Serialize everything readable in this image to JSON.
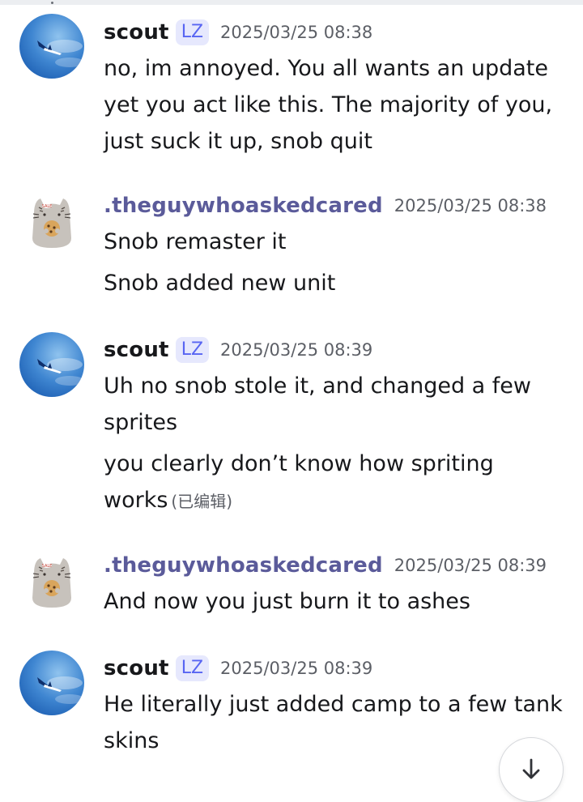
{
  "messages": [
    {
      "author": "scout",
      "tag": "LZ",
      "timestamp": "2025/03/25 08:38",
      "avatar": "blue-sky-plane-avatar",
      "lines": [
        "no, im annoyed. You all wants an update",
        "yet you act like this. The majority of you,",
        "just suck it up, snob quit"
      ]
    },
    {
      "author": ".theguywhoaskedcared",
      "timestamp": "2025/03/25 08:38",
      "avatar": "pusheen-cat-cookie-avatar",
      "lines": [
        "Snob remaster it",
        "Snob added new unit"
      ]
    },
    {
      "author": "scout",
      "tag": "LZ",
      "timestamp": "2025/03/25 08:39",
      "avatar": "blue-sky-plane-avatar",
      "lines": [
        "Uh no snob stole it, and changed a few",
        "sprites",
        "you clearly don’t know how spriting",
        "works"
      ],
      "edited_label": "(已编辑)"
    },
    {
      "author": ".theguywhoaskedcared",
      "timestamp": "2025/03/25 08:39",
      "avatar": "pusheen-cat-cookie-avatar",
      "lines": [
        "And now you just burn it to ashes"
      ]
    },
    {
      "author": "scout",
      "tag": "LZ",
      "timestamp": "2025/03/25 08:39",
      "avatar": "blue-sky-plane-avatar",
      "lines": [
        "He literally just added camp to a few tank",
        "skins"
      ]
    }
  ],
  "scroll_button_icon": "arrow-down-icon",
  "colors": {
    "accent": "#5865f2",
    "tag_bg": "#e6e8fd",
    "username_alt": "#5b5b9a",
    "timestamp": "#5c5f66"
  }
}
